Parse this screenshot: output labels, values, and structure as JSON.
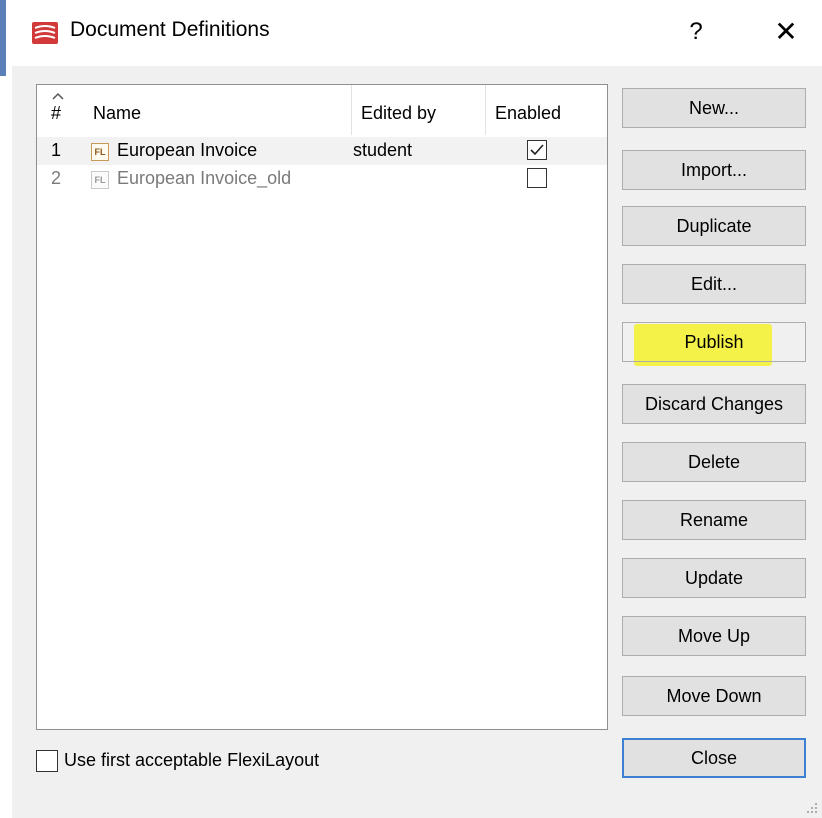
{
  "window": {
    "title": "Document Definitions",
    "help_label": "?",
    "close_glyph": "✕"
  },
  "list": {
    "columns": {
      "num": "#",
      "name": "Name",
      "edited_by": "Edited by",
      "enabled": "Enabled"
    },
    "rows": [
      {
        "num": "1",
        "icon_text": "FL",
        "name": "European Invoice",
        "edited_by": "student",
        "enabled": true
      },
      {
        "num": "2",
        "icon_text": "FL",
        "name": "European Invoice_old",
        "edited_by": "",
        "enabled": false
      }
    ]
  },
  "buttons": {
    "new": "New...",
    "import": "Import...",
    "duplicate": "Duplicate",
    "edit": "Edit...",
    "publish": "Publish",
    "discard": "Discard Changes",
    "delete": "Delete",
    "rename": "Rename",
    "update": "Update",
    "move_up": "Move Up",
    "move_down": "Move Down",
    "close": "Close"
  },
  "options": {
    "use_first_acceptable_label": "Use first acceptable FlexiLayout",
    "use_first_acceptable_checked": false
  },
  "colors": {
    "highlight": "#f4f12b",
    "default_button_border": "#3c7fd3",
    "app_icon": "#d23a3a"
  },
  "icons": {
    "app": "app-logo-icon",
    "file": "flexilayout-file-icon"
  }
}
